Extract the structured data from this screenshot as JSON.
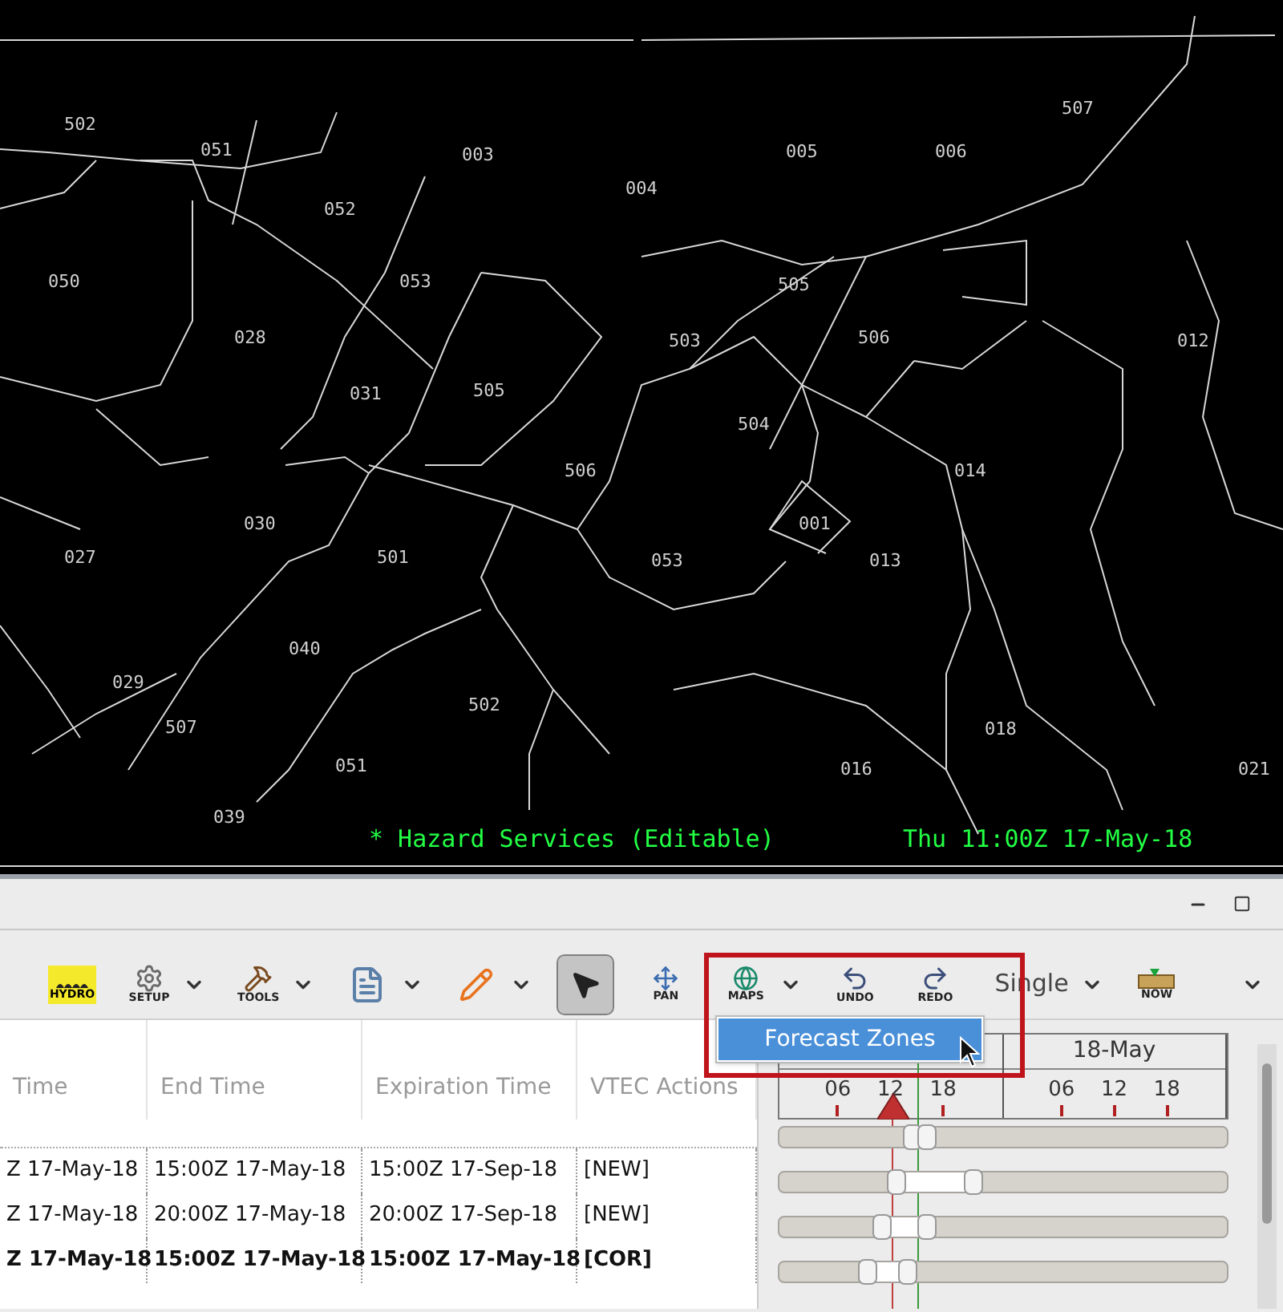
{
  "map": {
    "zone_labels": [
      "507",
      "502",
      "051",
      "003",
      "005",
      "006",
      "004",
      "052",
      "050",
      "053",
      "505",
      "028",
      "503",
      "506",
      "012",
      "031",
      "505",
      "504",
      "506",
      "014",
      "030",
      "001",
      "027",
      "501",
      "053",
      "013",
      "040",
      "029",
      "502",
      "507",
      "018",
      "051",
      "016",
      "021",
      "039"
    ],
    "status_left": "* Hazard Services (Editable)",
    "status_right": "Thu 11:00Z 17-May-18"
  },
  "toolbar": [
    {
      "kind": "hydro",
      "label": "HYDRO",
      "has_menu": false,
      "selected": false
    },
    {
      "kind": "setup",
      "label": "SETUP",
      "has_menu": true,
      "selected": false
    },
    {
      "kind": "tools",
      "label": "TOOLS",
      "has_menu": true,
      "selected": false
    },
    {
      "kind": "document",
      "has_menu": true,
      "selected": false
    },
    {
      "kind": "pencil",
      "has_menu": true,
      "selected": false
    },
    {
      "kind": "select",
      "has_menu": false,
      "selected": true
    },
    {
      "kind": "pan",
      "label": "PAN",
      "has_menu": false,
      "selected": false
    },
    {
      "kind": "maps",
      "label": "MAPS",
      "has_menu": true,
      "selected": false
    },
    {
      "kind": "undo",
      "label": "UNDO",
      "has_menu": false,
      "selected": false
    },
    {
      "kind": "redo",
      "label": "REDO",
      "has_menu": false,
      "selected": false
    },
    {
      "kind": "combo",
      "label": "Single",
      "has_menu": true,
      "selected": false
    },
    {
      "kind": "now",
      "label": "NOW",
      "has_menu": false,
      "selected": false
    },
    {
      "kind": "overflow",
      "has_menu": true,
      "selected": false
    }
  ],
  "maps_menu": {
    "items": [
      {
        "label": "Forecast Zones",
        "selected": true
      }
    ]
  },
  "table": {
    "columns": [
      "Time",
      "End Time",
      "Expiration Time",
      "VTEC Actions"
    ],
    "rows": [
      {
        "cells": [
          "Z 17-May-18",
          "15:00Z 17-May-18",
          "15:00Z 17-Sep-18",
          "[NEW]"
        ],
        "bold": false
      },
      {
        "cells": [
          "Z 17-May-18",
          "20:00Z 17-May-18",
          "20:00Z 17-Sep-18",
          "[NEW]"
        ],
        "bold": false
      },
      {
        "cells": [
          "Z 17-May-18",
          "15:00Z 17-May-18",
          "15:00Z 17-May-18",
          "[COR]"
        ],
        "bold": true
      }
    ]
  },
  "timeline": {
    "days": [
      {
        "hours": [
          "06",
          "12",
          "18"
        ]
      },
      {
        "label": "18-May",
        "hours": [
          "06",
          "12",
          "18"
        ]
      }
    ]
  }
}
